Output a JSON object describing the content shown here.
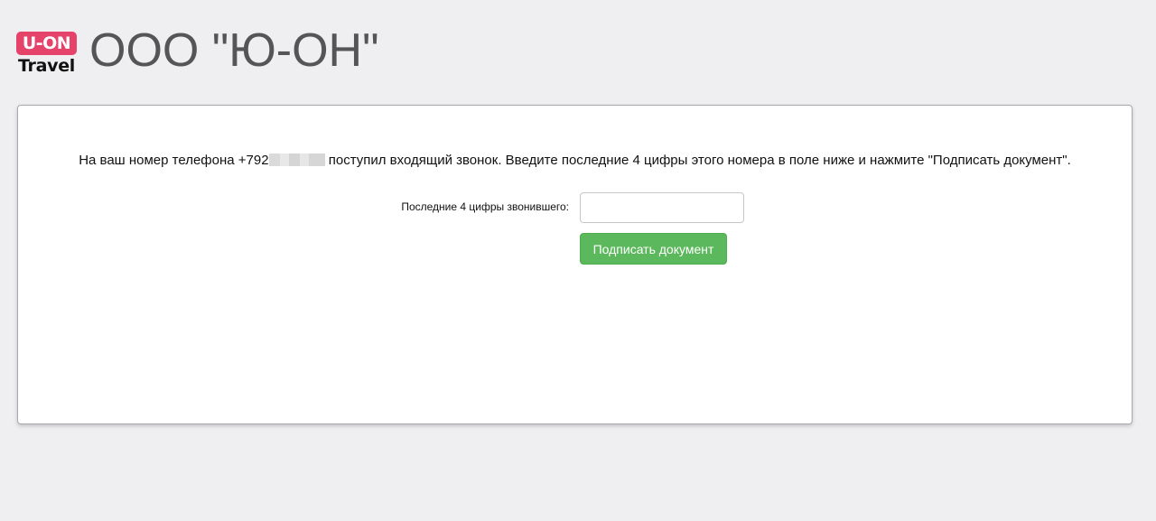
{
  "header": {
    "logo_top": "U-ON",
    "logo_bottom": "Travel",
    "company_name": "ООО \"Ю-ОН\""
  },
  "message": {
    "before": "На ваш номер телефона +792",
    "after": " поступил входящий звонок. Введите последние 4 цифры этого номера в поле ниже и нажмите \"Подписать документ\"."
  },
  "form": {
    "digits_label": "Последние 4 цифры звонившего:",
    "digits_value": "",
    "submit_label": "Подписать документ"
  },
  "colors": {
    "background": "#efeef0",
    "logo_accent": "#e5436a",
    "button": "#5cb85c"
  }
}
